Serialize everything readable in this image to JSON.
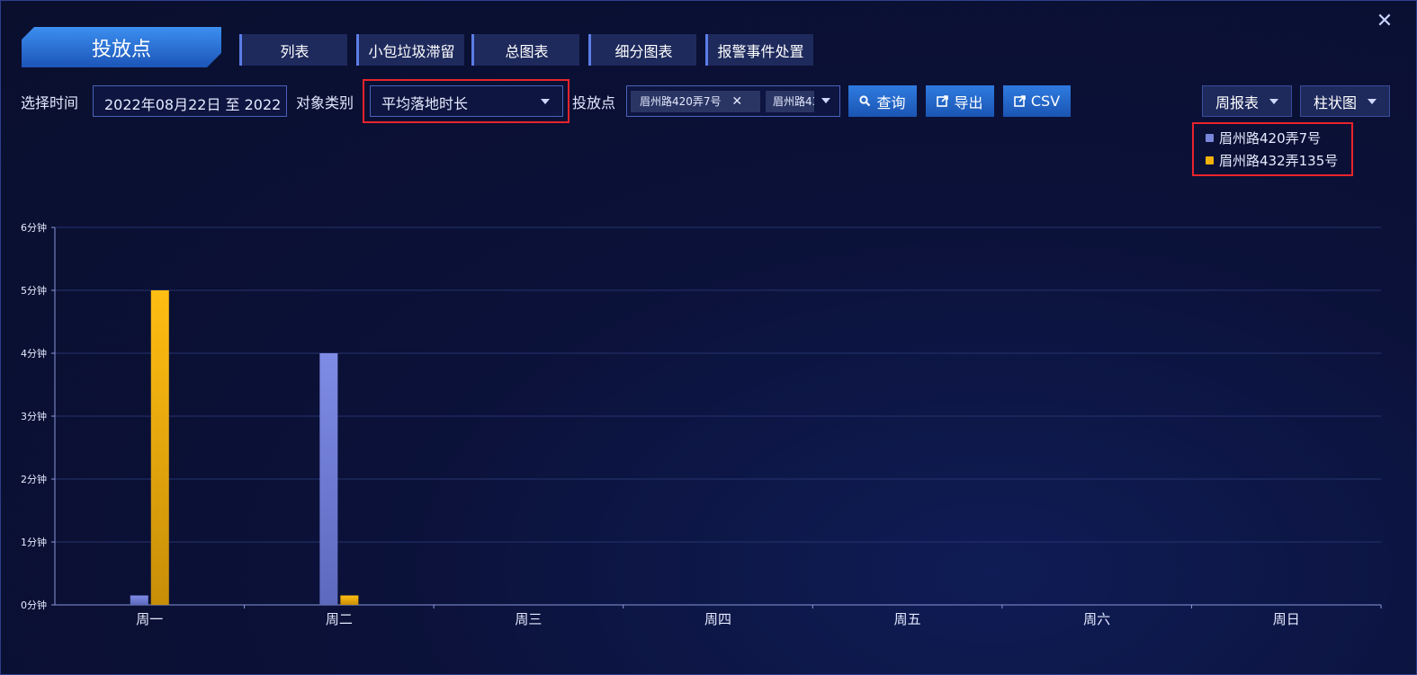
{
  "header": {
    "title": "投放点",
    "tabs": [
      {
        "label": "列表",
        "active": false
      },
      {
        "label": "小包垃圾滞留",
        "active": false
      },
      {
        "label": "总图表",
        "active": false
      },
      {
        "label": "细分图表",
        "active": true
      },
      {
        "label": "报警事件处置",
        "active": false
      }
    ],
    "close_icon": "✕"
  },
  "filters": {
    "time_label": "选择时间",
    "time_value": "2022年08月22日 至 2022",
    "type_label": "对象类别",
    "type_value": "平均落地时长",
    "point_label": "投放点",
    "point_chips": [
      "眉州路420弄7号",
      "眉州路432弄135号"
    ],
    "point_chip_remove": "✕",
    "query_button": "查询",
    "export_button": "导出",
    "csv_button": "CSV",
    "report_select": "周报表",
    "chart_select": "柱状图"
  },
  "colors": {
    "series1": "#7a86dc",
    "series2": "#f2b10c",
    "accent": "#2a66c9",
    "highlight": "#e8242c"
  },
  "chart_data": {
    "type": "bar",
    "categories": [
      "周一",
      "周二",
      "周三",
      "周四",
      "周五",
      "周六",
      "周日"
    ],
    "series": [
      {
        "name": "眉州路420弄7号",
        "values": [
          0.15,
          4,
          0,
          0,
          0,
          0,
          0
        ]
      },
      {
        "name": "眉州路432弄135号",
        "values": [
          5,
          0.15,
          0,
          0,
          0,
          0,
          0
        ]
      }
    ],
    "yticks": [
      "0分钟",
      "1分钟",
      "2分钟",
      "3分钟",
      "4分钟",
      "5分钟",
      "6分钟"
    ],
    "ylim": [
      0,
      6
    ],
    "grid": true,
    "legend_position": "top-right"
  }
}
